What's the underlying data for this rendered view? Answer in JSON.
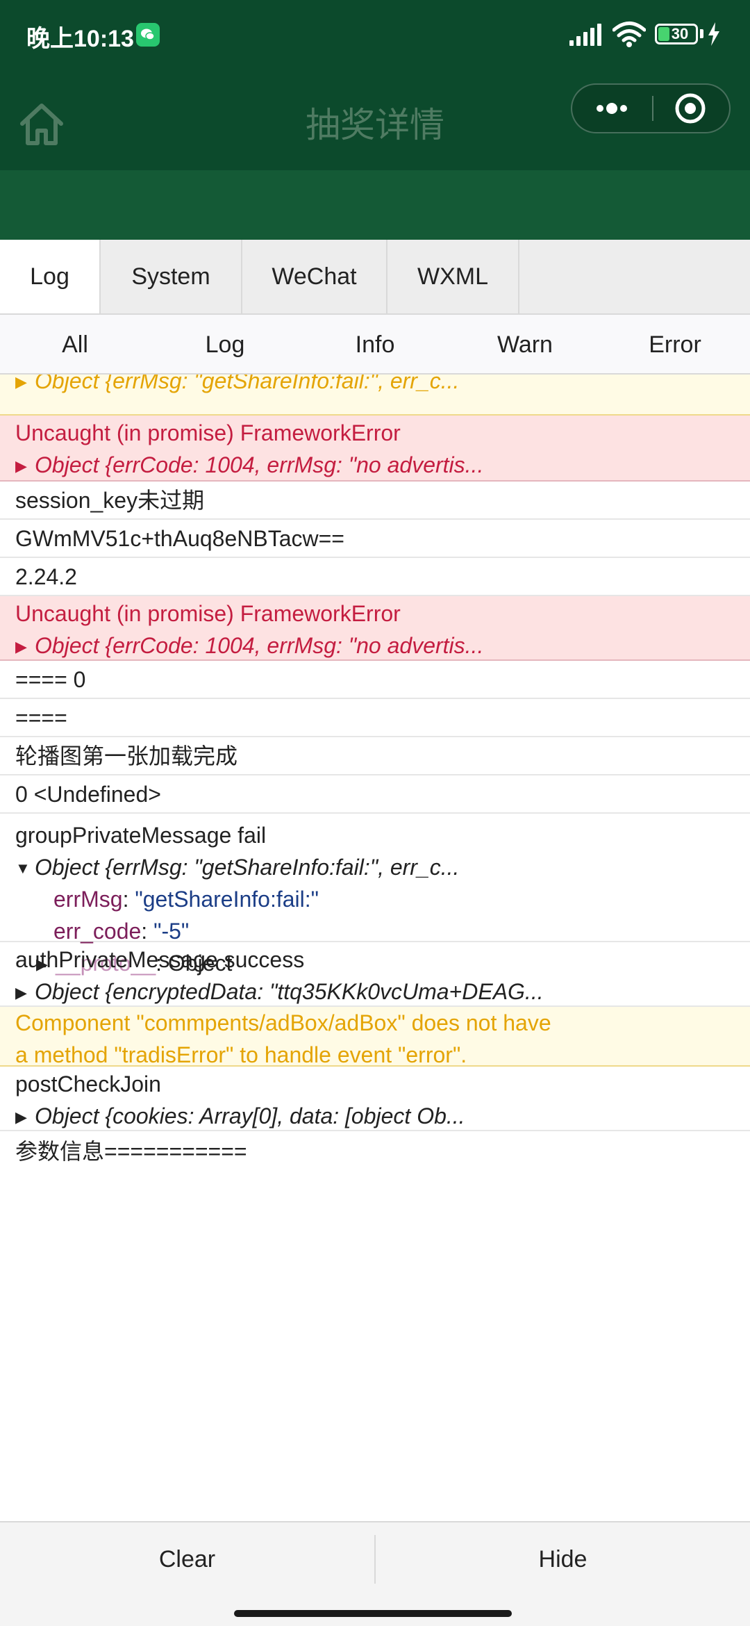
{
  "status_bar": {
    "time": "晚上10:13",
    "battery_level": "30",
    "battery_fraction": 0.3
  },
  "nav": {
    "title": "抽奖详情",
    "home_icon": "home-icon",
    "more_icon": "more-dots-icon",
    "close_icon": "target-circle-icon"
  },
  "tabs": [
    {
      "label": "Log",
      "active": true
    },
    {
      "label": "System",
      "active": false
    },
    {
      "label": "WeChat",
      "active": false
    },
    {
      "label": "WXML",
      "active": false
    }
  ],
  "filters": [
    "All",
    "Log",
    "Info",
    "Warn",
    "Error"
  ],
  "logs": {
    "partial_warn_obj": "Object {errMsg: \"getShareInfo:fail:\", err_c...",
    "error1_title": "Uncaught (in promise) FrameworkError",
    "error1_obj": "Object {errCode: 1004, errMsg: \"no advertis...",
    "log_session": "session_key未过期",
    "log_key": "GWmMV51c+thAuq8eNBTacw==",
    "log_version": "2.24.2",
    "error2_title": "Uncaught (in promise) FrameworkError",
    "error2_obj": "Object {errCode: 1004, errMsg: \"no advertis...",
    "log_eq0": "==== 0",
    "log_eq": "====",
    "log_carousel": "轮播图第一张加载完成",
    "log_undefined": "0 <Undefined>",
    "group_title": "groupPrivateMessage fail",
    "group_obj": "Object {errMsg: \"getShareInfo:fail:\", err_c...",
    "group_prop1_key": "errMsg",
    "group_prop1_val": "\"getShareInfo:fail:\"",
    "group_prop2_key": "err_code",
    "group_prop2_val": "\"-5\"",
    "group_proto_key": "__proto__",
    "group_proto_val": "Object",
    "auth_title": "authPrivateMessage success",
    "auth_obj": "Object {encryptedData: \"ttq35KKk0vcUma+DEAG...",
    "warn_line1": "Component \"commpents/adBox/adBox\" does not have",
    "warn_line2": "a method \"tradisError\" to handle event \"error\".",
    "post_title": "postCheckJoin",
    "post_obj": "Object {cookies: Array[0], data: [object Ob...",
    "params": "参数信息==========="
  },
  "toolbar": {
    "clear_label": "Clear",
    "hide_label": "Hide"
  },
  "colors": {
    "header_green": "#0c4a2c",
    "error_bg": "#fde2e2",
    "error_text": "#c41d40",
    "warn_bg": "#fffbe5",
    "warn_text": "#e4a405"
  }
}
